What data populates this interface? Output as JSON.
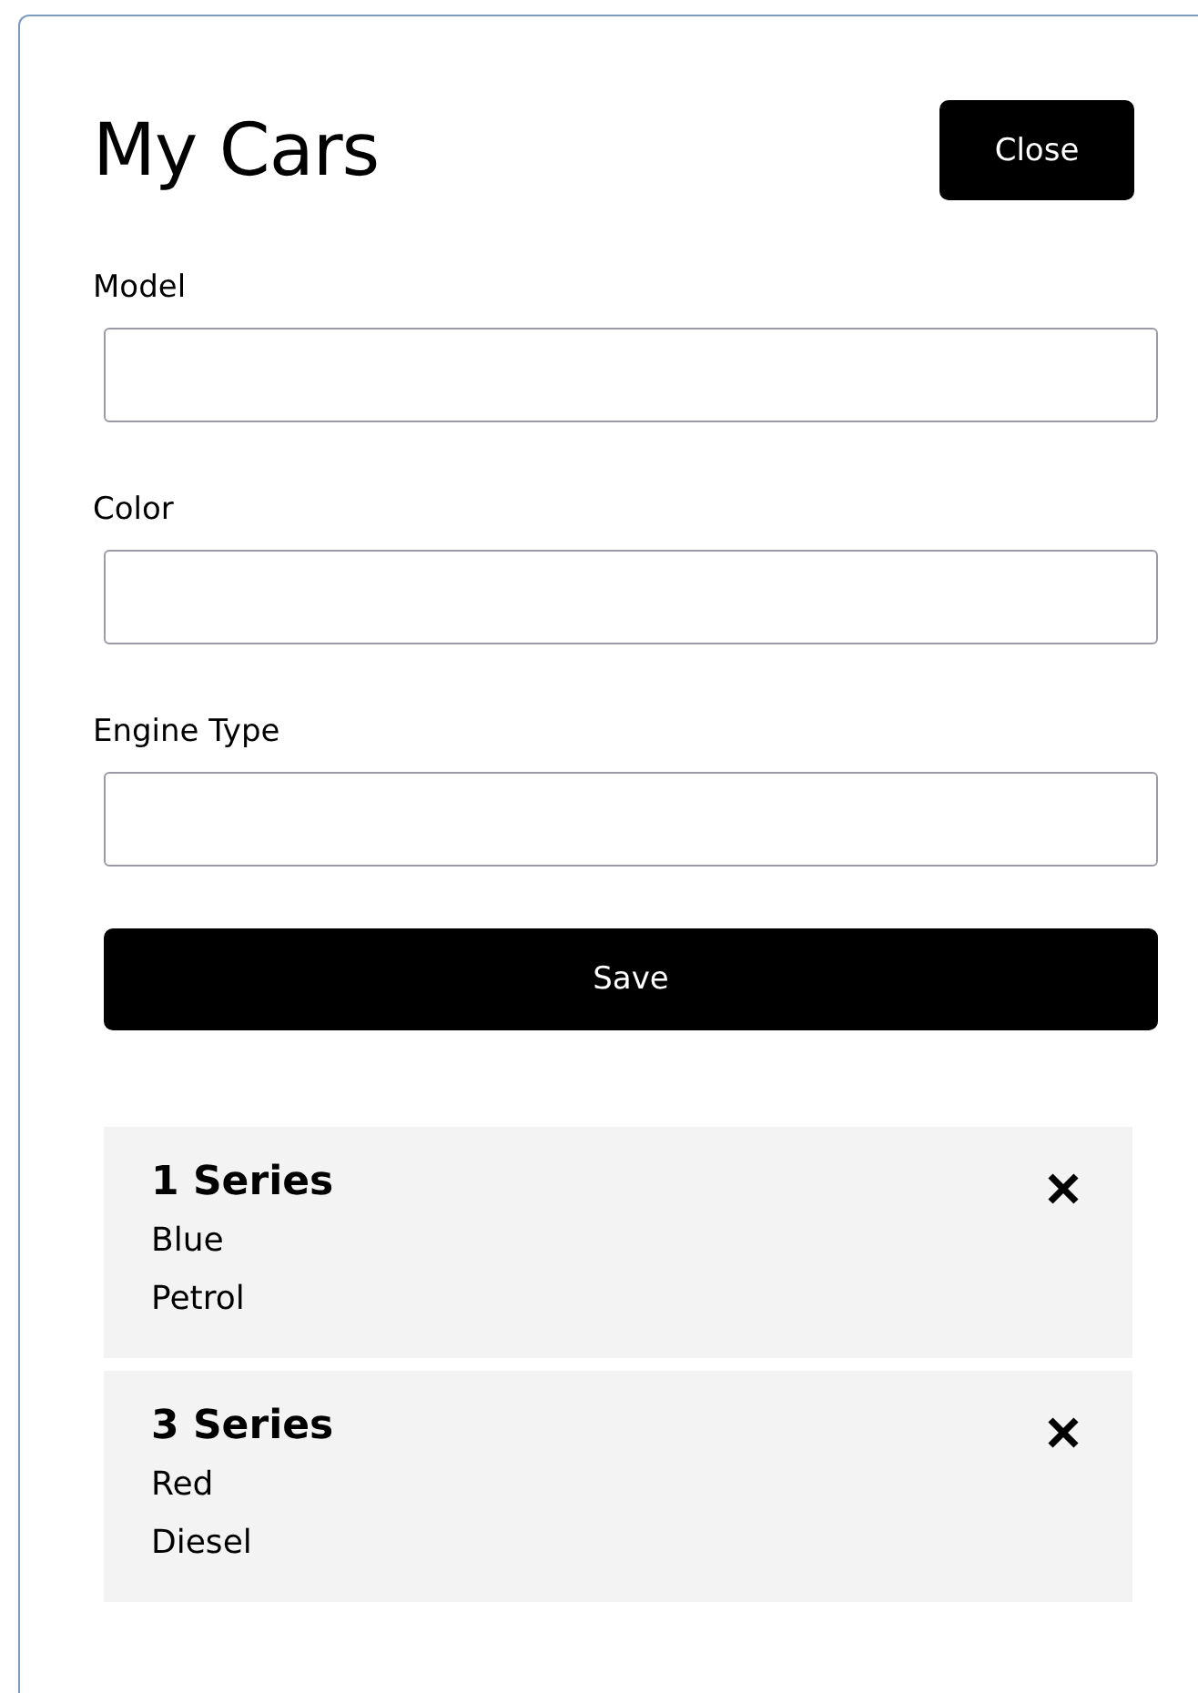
{
  "title": "My Cars",
  "close_button": "Close",
  "fields": [
    {
      "label": "Model"
    },
    {
      "label": "Color"
    },
    {
      "label": "Engine Type"
    }
  ],
  "save_button": "Save",
  "cars": [
    {
      "model": "1 Series",
      "paint": "Blue",
      "engine": "Petrol"
    },
    {
      "model": "3 Series",
      "paint": "Red",
      "engine": "Diesel"
    }
  ]
}
